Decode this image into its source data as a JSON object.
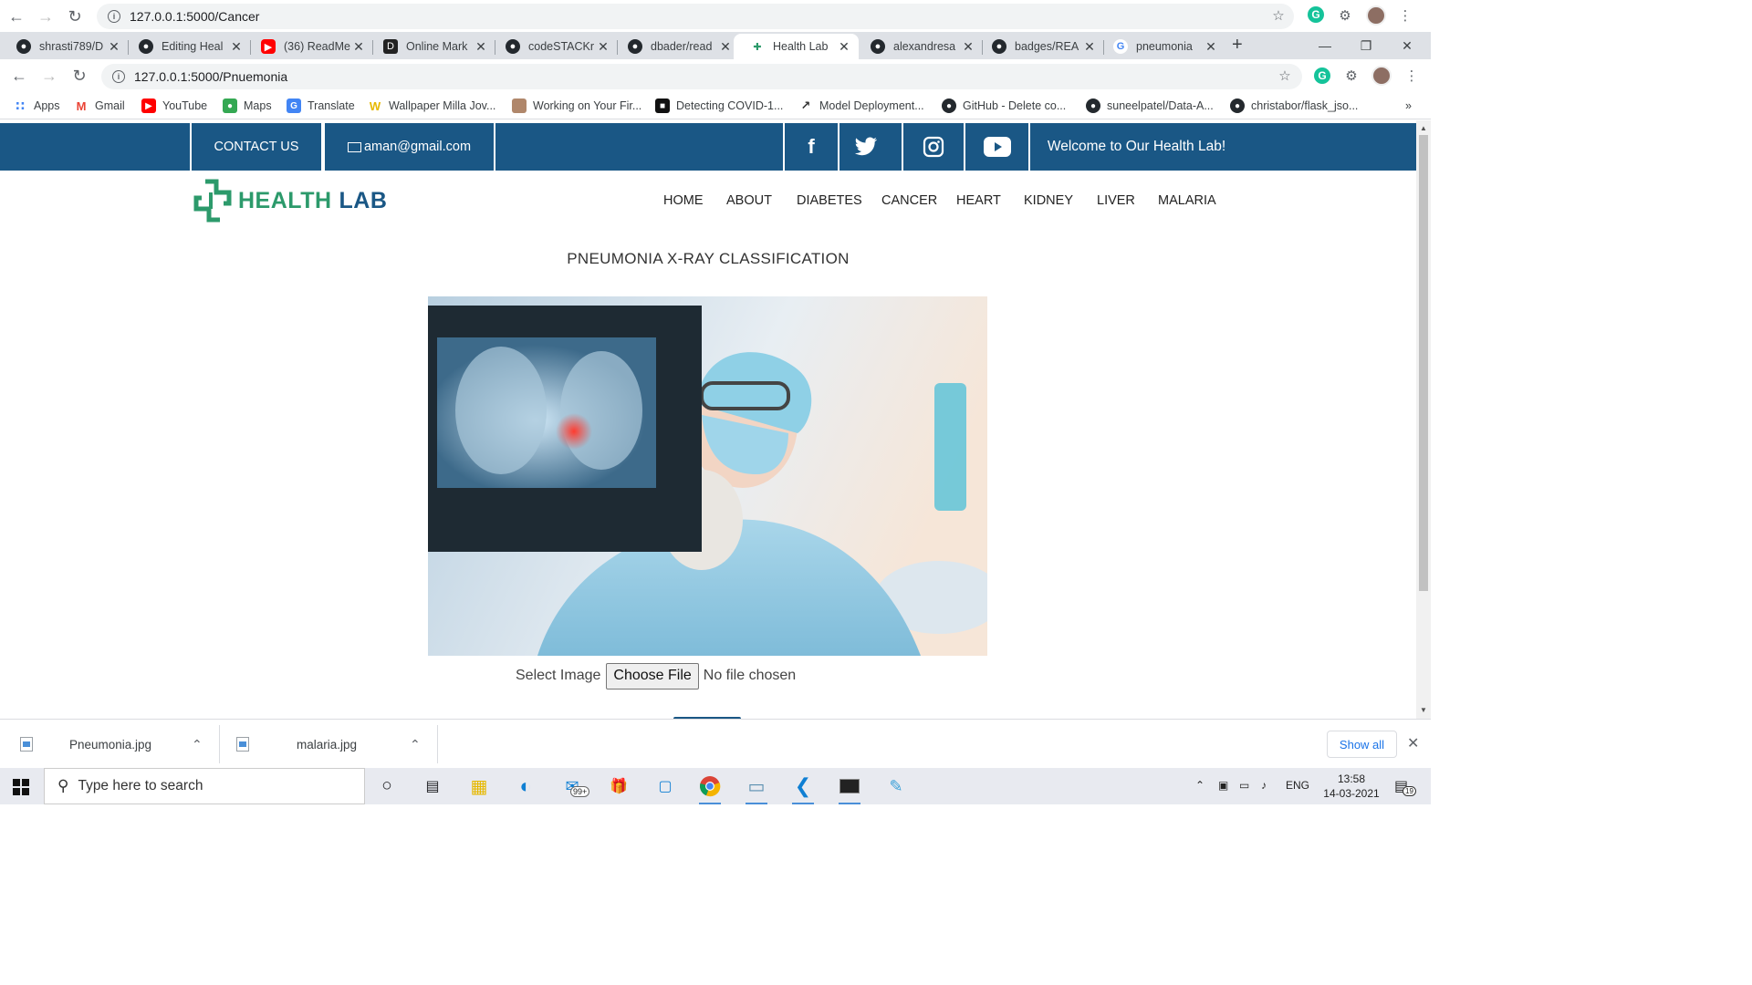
{
  "outer_window": {
    "url": "127.0.0.1:5000/Cancer"
  },
  "tabs": [
    {
      "title": "shrasti789/D",
      "icon": "github-icon"
    },
    {
      "title": "Editing Heal",
      "icon": "github-icon"
    },
    {
      "title": "(36) ReadMe",
      "icon": "youtube-icon"
    },
    {
      "title": "Online Mark",
      "icon": "d-icon"
    },
    {
      "title": "codeSTACKr",
      "icon": "github-icon"
    },
    {
      "title": "dbader/read",
      "icon": "github-icon"
    },
    {
      "title": "Health Lab",
      "icon": "healthlab-icon",
      "active": true
    },
    {
      "title": "alexandresa",
      "icon": "github-icon"
    },
    {
      "title": "badges/REA",
      "icon": "github-icon"
    },
    {
      "title": "pneumonia",
      "icon": "google-icon"
    }
  ],
  "toolbar": {
    "url": "127.0.0.1:5000/Pnuemonia"
  },
  "bookmarks": [
    {
      "label": "Apps"
    },
    {
      "label": "Gmail"
    },
    {
      "label": "YouTube"
    },
    {
      "label": "Maps"
    },
    {
      "label": "Translate"
    },
    {
      "label": "Wallpaper Milla Jov..."
    },
    {
      "label": "Working on Your Fir..."
    },
    {
      "label": "Detecting COVID-1..."
    },
    {
      "label": "Model Deployment..."
    },
    {
      "label": "GitHub - Delete co..."
    },
    {
      "label": "suneelpatel/Data-A..."
    },
    {
      "label": "christabor/flask_jso..."
    }
  ],
  "site": {
    "topbar": {
      "contact": "CONTACT US",
      "email": "aman@gmail.com",
      "welcome": "Welcome to Our Health Lab!"
    },
    "logo": {
      "part1": "HEALTH",
      "part2": "LAB"
    },
    "nav": [
      "HOME",
      "ABOUT",
      "DIABETES",
      "CANCER",
      "HEART",
      "KIDNEY",
      "LIVER",
      "MALARIA"
    ],
    "heading": "PNEUMONIA X-RAY CLASSIFICATION",
    "upload": {
      "label": "Select Image",
      "button": "Choose File",
      "status": "No file chosen"
    }
  },
  "downloads": [
    {
      "name": "Pneumonia.jpg"
    },
    {
      "name": "malaria.jpg"
    }
  ],
  "downloads_show_all": "Show all",
  "taskbar": {
    "search_placeholder": "Type here to search",
    "mail_badge": "99+",
    "lang": "ENG",
    "time": "13:58",
    "date": "14-03-2021",
    "notif_count": "19"
  }
}
